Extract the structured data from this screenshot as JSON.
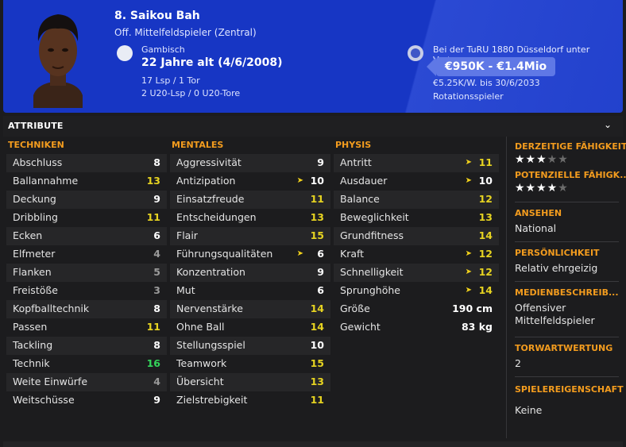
{
  "header": {
    "name": "8. Saikou Bah",
    "position": "Off. Mittelfeldspieler (Zentral)",
    "nationality": "Gambisch",
    "age": "22 Jahre alt (4/6/2008)",
    "caps": "17 Lsp / 1 Tor",
    "youth_caps": "2 U20-Lsp / 0 U20-Tore",
    "contract": "Bei der TuRU 1880 Düsseldorf unter Vertrag",
    "value": "€950K - €1.4Mio",
    "wage": "€5.25K/W. bis 30/6/2033",
    "role": "Rotationsspieler"
  },
  "section": {
    "title": "ATTRIBUTE"
  },
  "colors": {
    "accent": "#f39c1e",
    "header_bg": "#1736c4",
    "value_pill": "#5f78e6"
  },
  "technik": {
    "title": "TECHNIKEN",
    "rows": [
      {
        "name": "Abschluss",
        "value": "8"
      },
      {
        "name": "Ballannahme",
        "value": "13"
      },
      {
        "name": "Deckung",
        "value": "9"
      },
      {
        "name": "Dribbling",
        "value": "11"
      },
      {
        "name": "Ecken",
        "value": "6"
      },
      {
        "name": "Elfmeter",
        "value": "4"
      },
      {
        "name": "Flanken",
        "value": "5"
      },
      {
        "name": "Freistöße",
        "value": "3"
      },
      {
        "name": "Kopfballtechnik",
        "value": "8"
      },
      {
        "name": "Passen",
        "value": "11"
      },
      {
        "name": "Tackling",
        "value": "8"
      },
      {
        "name": "Technik",
        "value": "16"
      },
      {
        "name": "Weite Einwürfe",
        "value": "4"
      },
      {
        "name": "Weitschüsse",
        "value": "9"
      }
    ]
  },
  "mental": {
    "title": "MENTALES",
    "rows": [
      {
        "name": "Aggressivität",
        "value": "9"
      },
      {
        "name": "Antizipation",
        "value": "10"
      },
      {
        "name": "Einsatzfreude",
        "value": "11"
      },
      {
        "name": "Entscheidungen",
        "value": "13"
      },
      {
        "name": "Flair",
        "value": "15"
      },
      {
        "name": "Führungsqualitäten",
        "value": "6"
      },
      {
        "name": "Konzentration",
        "value": "9"
      },
      {
        "name": "Mut",
        "value": "6"
      },
      {
        "name": "Nervenstärke",
        "value": "14"
      },
      {
        "name": "Ohne Ball",
        "value": "14"
      },
      {
        "name": "Stellungsspiel",
        "value": "10"
      },
      {
        "name": "Teamwork",
        "value": "15"
      },
      {
        "name": "Übersicht",
        "value": "13"
      },
      {
        "name": "Zielstrebigkeit",
        "value": "11"
      }
    ]
  },
  "physis": {
    "title": "PHYSIS",
    "rows": [
      {
        "name": "Antritt",
        "value": "11"
      },
      {
        "name": "Ausdauer",
        "value": "10"
      },
      {
        "name": "Balance",
        "value": "12"
      },
      {
        "name": "Beweglichkeit",
        "value": "13"
      },
      {
        "name": "Grundfitness",
        "value": "14"
      },
      {
        "name": "Kraft",
        "value": "12"
      },
      {
        "name": "Schnelligkeit",
        "value": "12"
      },
      {
        "name": "Sprunghöhe",
        "value": "14"
      }
    ],
    "height_label": "Größe",
    "height": "190 cm",
    "weight_label": "Gewicht",
    "weight": "83 kg"
  },
  "side": {
    "current_ability_label": "DERZEITIGE FÄHIGKEIT",
    "current_ability_stars": 3,
    "potential_ability_label": "POTENZIELLE FÄHIGK...",
    "potential_ability_stars": 4,
    "reputation_label": "ANSEHEN",
    "reputation": "National",
    "personality_label": "PERSÖNLICHKEIT",
    "personality": "Relativ ehrgeizig",
    "media_label": "MEDIENBESCHREIB...",
    "media": "Offensiver Mittelfeldspieler",
    "gk_label": "TORWARTWERTUNG",
    "gk": "2",
    "traits_label": "SPIELEREIGENSCHAFT",
    "traits": "Keine"
  }
}
